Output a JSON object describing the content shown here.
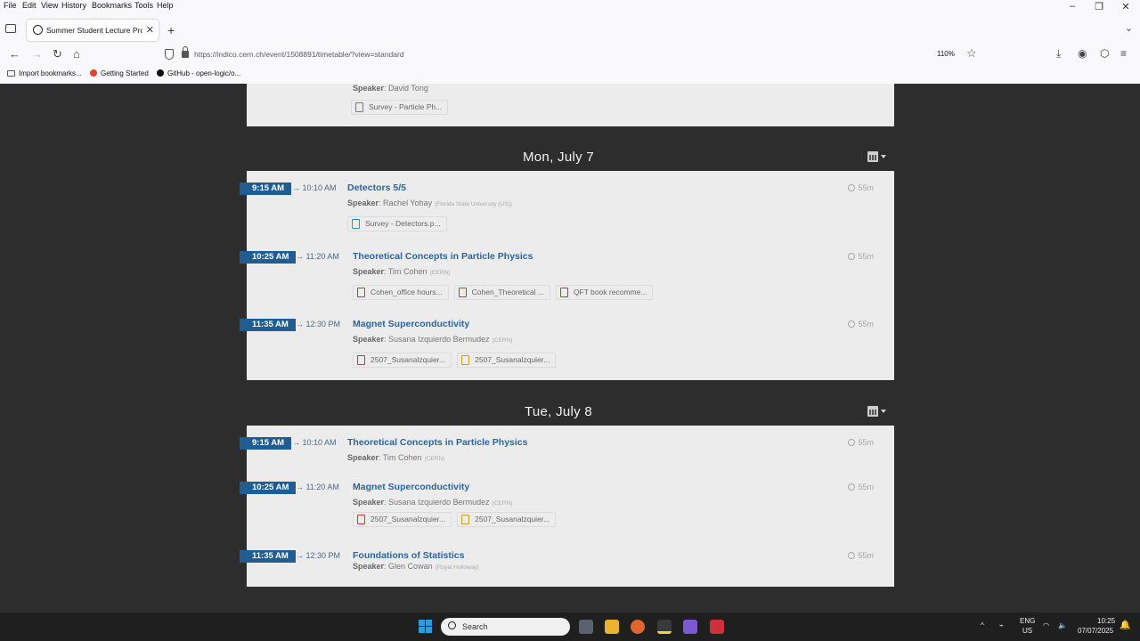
{
  "browser": {
    "menu": [
      "File",
      "Edit",
      "View",
      "History",
      "Bookmarks",
      "Tools",
      "Help"
    ],
    "tab_title": "Summer Student Lecture Prog",
    "url": "https://indico.cern.ch/event/1508891/timetable/?view=standard",
    "zoom": "110%",
    "bookmarks": [
      "Import bookmarks...",
      "Getting Started",
      "GitHub - open-logic/o..."
    ]
  },
  "timetable": {
    "prev_day": {
      "speaker_label": "Speaker",
      "speaker": "David Tong",
      "attachments": [
        {
          "name": "Survey - Particle Ph...",
          "type": "img"
        }
      ]
    },
    "days": [
      {
        "title": "Mon, July 7",
        "entries": [
          {
            "start": "9:15 AM",
            "end": "→ 10:10 AM",
            "title": "Detectors 5/5",
            "duration": "55m",
            "speaker_label": "Speaker",
            "speaker": "Rachel Yohay",
            "affiliation": "(Florida State University (US))",
            "attachments": [
              {
                "name": "Survey - Detectors.p...",
                "type": "img"
              }
            ]
          },
          {
            "start": "10:25 AM",
            "end": "→ 11:20 AM",
            "title": "Theoretical Concepts in Particle Physics",
            "duration": "55m",
            "speaker_label": "Speaker",
            "speaker": "Tim Cohen",
            "affiliation": "(CERN)",
            "attachments": [
              {
                "name": "Cohen_office hours...",
                "type": "pdf"
              },
              {
                "name": "Cohen_Theoretical ...",
                "type": "pdf"
              },
              {
                "name": "QFT book recomme...",
                "type": "pdf"
              }
            ]
          },
          {
            "start": "11:35 AM",
            "end": "→ 12:30 PM",
            "title": "Magnet Superconductivity",
            "duration": "55m",
            "speaker_label": "Speaker",
            "speaker": "Susana Izquierdo Bermudez",
            "affiliation": "(CERN)",
            "attachments": [
              {
                "name": "2507_Susanalzquier...",
                "type": "pdf"
              },
              {
                "name": "2507_Susanalzquier...",
                "type": "doc"
              }
            ]
          }
        ]
      },
      {
        "title": "Tue, July 8",
        "entries": [
          {
            "start": "9:15 AM",
            "end": "→ 10:10 AM",
            "title": "Theoretical Concepts in Particle Physics",
            "duration": "55m",
            "speaker_label": "Speaker",
            "speaker": "Tim Cohen",
            "affiliation": "(CERN)",
            "attachments": []
          },
          {
            "start": "10:25 AM",
            "end": "→ 11:20 AM",
            "title": "Magnet Superconductivity",
            "duration": "55m",
            "speaker_label": "Speaker",
            "speaker": "Susana Izquierdo Bermudez",
            "affiliation": "(CERN)",
            "attachments": [
              {
                "name": "2507_Susanalzquier...",
                "type": "pdf"
              },
              {
                "name": "2507_Susanalzquier...",
                "type": "doc"
              }
            ]
          },
          {
            "start": "11:35 AM",
            "end": "→ 12:30 PM",
            "title": "Foundations of Statistics",
            "duration": "55m",
            "speaker_label": "Speaker",
            "speaker": "Glen Cowan",
            "affiliation": "(Royal Holloway)",
            "attachments": []
          }
        ]
      }
    ]
  },
  "taskbar": {
    "search_placeholder": "Search",
    "lang_top": "ENG",
    "lang_bottom": "US",
    "time": "10:25",
    "date": "07/07/2025"
  }
}
